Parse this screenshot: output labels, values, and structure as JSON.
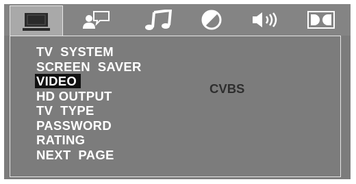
{
  "tabs": [
    {
      "icon": "monitor-icon",
      "active": true
    },
    {
      "icon": "speaker-chat-icon",
      "active": false
    },
    {
      "icon": "music-note-icon",
      "active": false
    },
    {
      "icon": "half-circle-icon",
      "active": false
    },
    {
      "icon": "volume-icon",
      "active": false
    },
    {
      "icon": "dolby-icon",
      "active": false
    }
  ],
  "menu": {
    "items": [
      {
        "label": "TV  SYSTEM"
      },
      {
        "label": "SCREEN  SAVER"
      },
      {
        "label": "VIDEO"
      },
      {
        "label": "HD OUTPUT"
      },
      {
        "label": "TV  TYPE"
      },
      {
        "label": "PASSWORD"
      },
      {
        "label": "RATING"
      },
      {
        "label": "NEXT  PAGE"
      }
    ],
    "selected_index": 2,
    "selected_value": "CVBS"
  },
  "colors": {
    "background": "#7c7c7c",
    "text": "#ffffff",
    "highlight": "#111111",
    "value_text": "#2e2e2e",
    "icon": "#ffffff",
    "active_tab": "#a9a9a9"
  }
}
